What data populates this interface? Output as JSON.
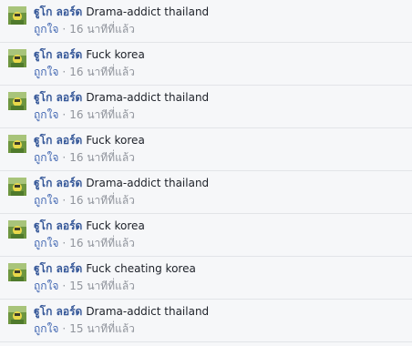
{
  "comments": [
    {
      "author": "ฐูโก ลอร์ด",
      "text": "Drama-addict thailand",
      "like_label": "ถูกใจ",
      "separator": "·",
      "time": "16 นาทีที่แล้ว"
    },
    {
      "author": "ฐูโก ลอร์ด",
      "text": "Fuck korea",
      "like_label": "ถูกใจ",
      "separator": "·",
      "time": "16 นาทีที่แล้ว"
    },
    {
      "author": "ฐูโก ลอร์ด",
      "text": "Drama-addict thailand",
      "like_label": "ถูกใจ",
      "separator": "·",
      "time": "16 นาทีที่แล้ว"
    },
    {
      "author": "ฐูโก ลอร์ด",
      "text": "Fuck korea",
      "like_label": "ถูกใจ",
      "separator": "·",
      "time": "16 นาทีที่แล้ว"
    },
    {
      "author": "ฐูโก ลอร์ด",
      "text": "Drama-addict thailand",
      "like_label": "ถูกใจ",
      "separator": "·",
      "time": "16 นาทีที่แล้ว"
    },
    {
      "author": "ฐูโก ลอร์ด",
      "text": "Fuck korea",
      "like_label": "ถูกใจ",
      "separator": "·",
      "time": "16 นาทีที่แล้ว"
    },
    {
      "author": "ฐูโก ลอร์ด",
      "text": "Fuck cheating korea",
      "like_label": "ถูกใจ",
      "separator": "·",
      "time": "15 นาทีที่แล้ว"
    },
    {
      "author": "ฐูโก ลอร์ด",
      "text": "Drama-addict thailand",
      "like_label": "ถูกใจ",
      "separator": "·",
      "time": "15 นาทีที่แล้ว"
    }
  ],
  "colors": {
    "author": "#365899",
    "text": "#1d2129",
    "like": "#4267b2",
    "meta": "#90949c",
    "background": "#f6f7f9",
    "divider": "#e2e4e8"
  },
  "icons": {
    "avatar": "profile-picture-avatar-icon"
  }
}
